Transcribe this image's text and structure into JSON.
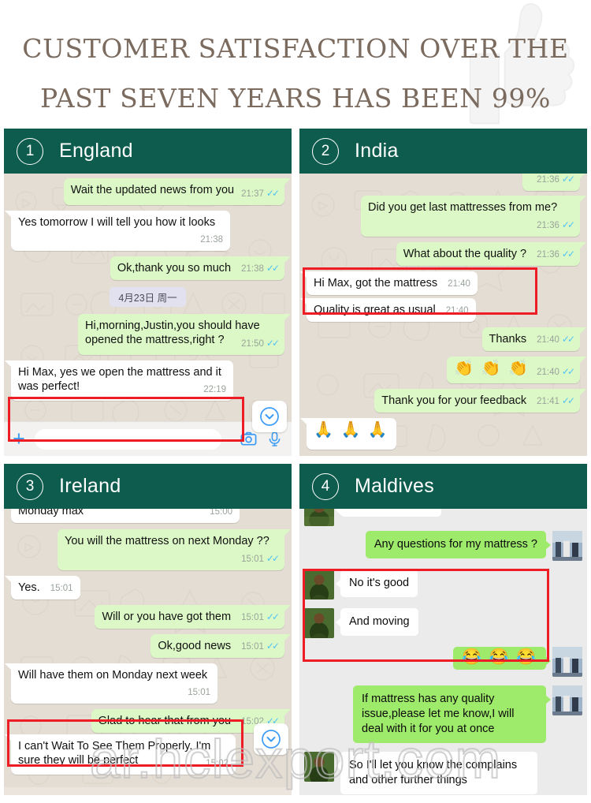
{
  "header": {
    "title_line1": "CUSTOMER SATISFACTION OVER THE",
    "title_line2": "PAST SEVEN YEARS HAS BEEN 99%",
    "watermark_icon": "thumbs-up-icon",
    "title_color": "#7b6a5e"
  },
  "watermark": {
    "text": "ar.hclexport.com"
  },
  "theme": {
    "bar_green": "#0d5c4d",
    "outgoing_bubble": "#DCF8C6",
    "incoming_bubble": "#FFFFFF",
    "wechat_bubble": "#9EEA6A",
    "highlight_red": "#EE1C25",
    "chat_background": "#E4DDD4",
    "tick_blue": "#4fc3f7",
    "accent_blue": "#3b9bf5"
  },
  "panels": [
    {
      "number": "1",
      "title": "England",
      "app": "whatsapp",
      "input_bar": {
        "plus_label": "+",
        "placeholder": "",
        "value": "",
        "camera_icon": "camera-icon",
        "mic_icon": "microphone-icon"
      },
      "scroll_button_icon": "chevron-down-circle-icon",
      "messages": [
        {
          "dir": "out",
          "text": "Wait the updated news from you",
          "time": "21:37",
          "ticks": "read"
        },
        {
          "dir": "in",
          "text": "Yes tomorrow I will tell you how it looks",
          "time": "21:38",
          "ticks": "none"
        },
        {
          "dir": "out",
          "text": "Ok,thank you so much",
          "time": "21:38",
          "ticks": "read",
          "inline": true
        },
        {
          "type": "date",
          "text": "4月23日 周一"
        },
        {
          "dir": "out",
          "text": "Hi,morning,Justin,you should have opened the mattress,right ?",
          "time": "21:50",
          "ticks": "read"
        },
        {
          "dir": "in",
          "text": "Hi Max, yes we open the mattress and it was perfect!",
          "time": "22:19",
          "ticks": "none",
          "highlighted": true
        }
      ]
    },
    {
      "number": "2",
      "title": "India",
      "app": "whatsapp",
      "messages": [
        {
          "dir": "out",
          "text": "",
          "time": "21:36",
          "ticks": "read",
          "cutoff": true
        },
        {
          "dir": "out",
          "text": "Did you get last mattresses from me?",
          "time": "21:36",
          "ticks": "read"
        },
        {
          "dir": "out",
          "text": "What about the quality ?",
          "time": "21:36",
          "ticks": "read",
          "inline": true
        },
        {
          "dir": "in",
          "text": "Hi Max, got the mattress",
          "time": "21:40",
          "ticks": "none",
          "inline": true,
          "highlighted": true
        },
        {
          "dir": "in",
          "text": "Quality is great as usual",
          "time": "21:40",
          "ticks": "none",
          "inline": true,
          "highlighted": true
        },
        {
          "dir": "out",
          "text": "Thanks",
          "time": "21:40",
          "ticks": "read",
          "inline": true
        },
        {
          "dir": "out",
          "text": "👏 👏 👏",
          "time": "21:40",
          "ticks": "read",
          "emoji": true
        },
        {
          "dir": "out",
          "text": "Thank you for your feedback",
          "time": "21:41",
          "ticks": "read",
          "inline": true
        },
        {
          "dir": "in",
          "text": "🙏 🙏 🙏",
          "time": "",
          "ticks": "none",
          "emoji": true,
          "cutoff": true
        }
      ]
    },
    {
      "number": "3",
      "title": "Ireland",
      "app": "whatsapp",
      "scroll_button_icon": "chevron-down-circle-icon",
      "messages": [
        {
          "dir": "in",
          "text": "Monday max",
          "time": "15:00",
          "ticks": "none",
          "cutoff_top": true,
          "inline": true
        },
        {
          "dir": "out",
          "text": "You will the mattress on next Monday ??",
          "time": "15:01",
          "ticks": "read"
        },
        {
          "dir": "in",
          "text": "Yes.",
          "time": "15:01",
          "ticks": "none",
          "inline": true
        },
        {
          "dir": "out",
          "text": "Will or you have got them",
          "time": "15:01",
          "ticks": "read",
          "inline": true
        },
        {
          "dir": "out",
          "text": "Ok,good news",
          "time": "15:01",
          "ticks": "read",
          "inline": true
        },
        {
          "dir": "in",
          "text": "Will have them on Monday next week",
          "time": "15:01",
          "ticks": "none"
        },
        {
          "dir": "out",
          "text": "Glad to hear that from you",
          "time": "15:02",
          "ticks": "read",
          "inline": true
        },
        {
          "dir": "in",
          "text": "I can't Wait To See Them Properly.  I'm sure they will be perfect",
          "time": "15:02",
          "ticks": "none",
          "highlighted": true
        }
      ]
    },
    {
      "number": "4",
      "title": "Maldives",
      "app": "wechat",
      "messages": [
        {
          "dir": "in",
          "text": "",
          "cutoff_top": true,
          "avatar": "contact-avatar"
        },
        {
          "dir": "out",
          "text": "Any questions for my mattress ?",
          "avatar": "user-avatar"
        },
        {
          "dir": "in",
          "text": "No it's good",
          "avatar": "contact-avatar",
          "highlighted": true
        },
        {
          "dir": "in",
          "text": "And moving",
          "avatar": "contact-avatar",
          "highlighted": true
        },
        {
          "dir": "out",
          "text": "😂 😂 😂",
          "avatar": "user-avatar",
          "emoji": true
        },
        {
          "dir": "out",
          "text": "If mattress has any quality issue,please let me know,I will deal with it for you at once",
          "avatar": "user-avatar"
        },
        {
          "dir": "in",
          "text": "So I'll let you know the complains and other further things",
          "avatar": "contact-avatar",
          "cutoff": true
        }
      ]
    }
  ]
}
